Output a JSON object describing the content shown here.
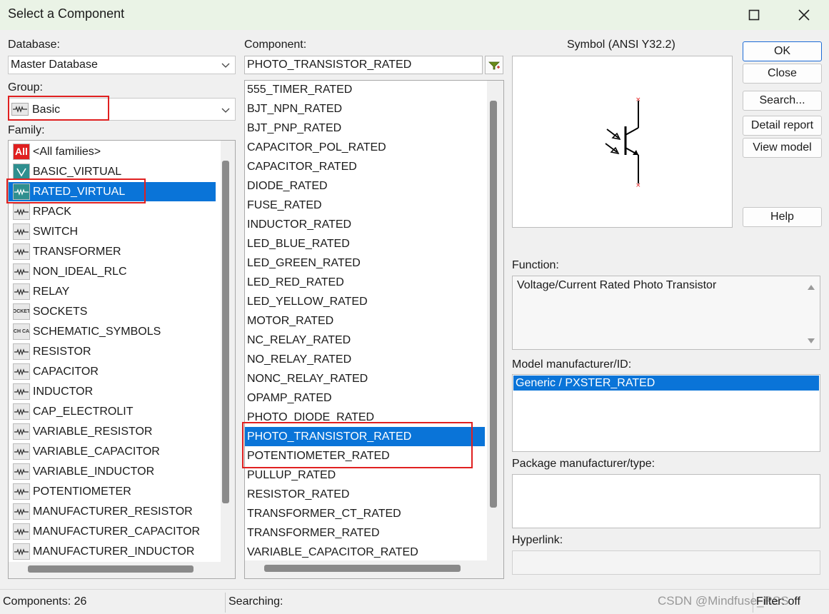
{
  "window": {
    "title": "Select a Component"
  },
  "database": {
    "label": "Database:",
    "value": "Master Database"
  },
  "group": {
    "label": "Group:",
    "value": "Basic"
  },
  "family": {
    "label": "Family:",
    "items": [
      {
        "label": "<All families>",
        "icon": "all-families-icon"
      },
      {
        "label": "BASIC_VIRTUAL",
        "icon": "basic-virtual-icon"
      },
      {
        "label": "RATED_VIRTUAL",
        "icon": "rated-virtual-icon"
      },
      {
        "label": "RPACK",
        "icon": "rpack-icon"
      },
      {
        "label": "SWITCH",
        "icon": "switch-icon"
      },
      {
        "label": "TRANSFORMER",
        "icon": "transformer-icon"
      },
      {
        "label": "NON_IDEAL_RLC",
        "icon": "non-ideal-rlc-icon"
      },
      {
        "label": "RELAY",
        "icon": "relay-icon"
      },
      {
        "label": "SOCKETS",
        "icon": "sockets-icon"
      },
      {
        "label": "SCHEMATIC_SYMBOLS",
        "icon": "schematic-symbols-icon"
      },
      {
        "label": "RESISTOR",
        "icon": "resistor-icon"
      },
      {
        "label": "CAPACITOR",
        "icon": "capacitor-icon"
      },
      {
        "label": "INDUCTOR",
        "icon": "inductor-icon"
      },
      {
        "label": "CAP_ELECTROLIT",
        "icon": "cap-electrolit-icon"
      },
      {
        "label": "VARIABLE_RESISTOR",
        "icon": "variable-resistor-icon"
      },
      {
        "label": "VARIABLE_CAPACITOR",
        "icon": "variable-capacitor-icon"
      },
      {
        "label": "VARIABLE_INDUCTOR",
        "icon": "variable-inductor-icon"
      },
      {
        "label": "POTENTIOMETER",
        "icon": "potentiometer-icon"
      },
      {
        "label": "MANUFACTURER_RESISTOR",
        "icon": "manufacturer-resistor-icon"
      },
      {
        "label": "MANUFACTURER_CAPACITOR",
        "icon": "manufacturer-capacitor-icon"
      },
      {
        "label": "MANUFACTURER_INDUCTOR",
        "icon": "manufacturer-inductor-icon"
      }
    ],
    "icon_text": {
      "all": "All",
      "sockets": "SOCKETS",
      "schematic": "SCH CAP"
    }
  },
  "component": {
    "label": "Component:",
    "value": "PHOTO_TRANSISTOR_RATED",
    "items": [
      "555_TIMER_RATED",
      "BJT_NPN_RATED",
      "BJT_PNP_RATED",
      "CAPACITOR_POL_RATED",
      "CAPACITOR_RATED",
      "DIODE_RATED",
      "FUSE_RATED",
      "INDUCTOR_RATED",
      "LED_BLUE_RATED",
      "LED_GREEN_RATED",
      "LED_RED_RATED",
      "LED_YELLOW_RATED",
      "MOTOR_RATED",
      "NC_RELAY_RATED",
      "NO_RELAY_RATED",
      "NONC_RELAY_RATED",
      "OPAMP_RATED",
      "PHOTO_DIODE_RATED",
      "PHOTO_TRANSISTOR_RATED",
      "POTENTIOMETER_RATED",
      "PULLUP_RATED",
      "RESISTOR_RATED",
      "TRANSFORMER_CT_RATED",
      "TRANSFORMER_RATED",
      "VARIABLE_CAPACITOR_RATED"
    ]
  },
  "symbol": {
    "label": "Symbol (ANSI Y32.2)"
  },
  "buttons": {
    "ok": "OK",
    "close": "Close",
    "search": "Search...",
    "detail_report": "Detail report",
    "view_model": "View model",
    "help": "Help"
  },
  "function": {
    "label": "Function:",
    "value": "Voltage/Current Rated Photo Transistor"
  },
  "model": {
    "label": "Model manufacturer/ID:",
    "selected": "Generic / PXSTER_RATED"
  },
  "package": {
    "label": "Package manufacturer/type:"
  },
  "hyperlink": {
    "label": "Hyperlink:"
  },
  "status": {
    "components": "Components: 26",
    "searching": "Searching:",
    "filter": "Filter: off"
  },
  "watermark": "CSDN @Mindfuse_RSS",
  "colors": {
    "selection": "#0a74d8",
    "title_bar": "#eaf3e6",
    "highlight_box": "#e02020"
  }
}
